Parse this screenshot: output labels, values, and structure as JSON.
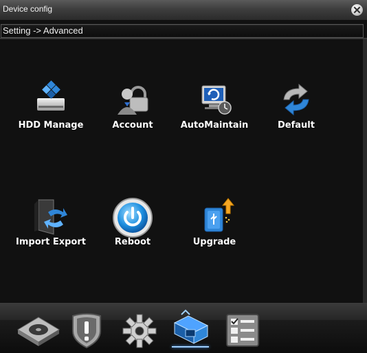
{
  "window": {
    "title": "Device config"
  },
  "breadcrumb": "Setting -> Advanced",
  "tiles": [
    {
      "label": "HDD Manage",
      "icon": "hdd-manage-icon"
    },
    {
      "label": "Account",
      "icon": "account-lock-icon"
    },
    {
      "label": "AutoMaintain",
      "icon": "auto-maintain-icon"
    },
    {
      "label": "Default",
      "icon": "default-refresh-icon"
    },
    {
      "label": "Import Export",
      "icon": "import-export-icon"
    },
    {
      "label": "Reboot",
      "icon": "reboot-power-icon"
    },
    {
      "label": "Upgrade",
      "icon": "upgrade-usb-icon"
    }
  ],
  "bottom_nav": [
    {
      "icon": "storage-disk-icon",
      "active": false
    },
    {
      "icon": "alarm-shield-icon",
      "active": false
    },
    {
      "icon": "system-gear-icon",
      "active": false
    },
    {
      "icon": "advanced-icon",
      "active": true
    },
    {
      "icon": "info-checklist-icon",
      "active": false
    }
  ],
  "colors": {
    "accent": "#4fa3ff",
    "background": "#111111",
    "text": "#ffffff"
  }
}
